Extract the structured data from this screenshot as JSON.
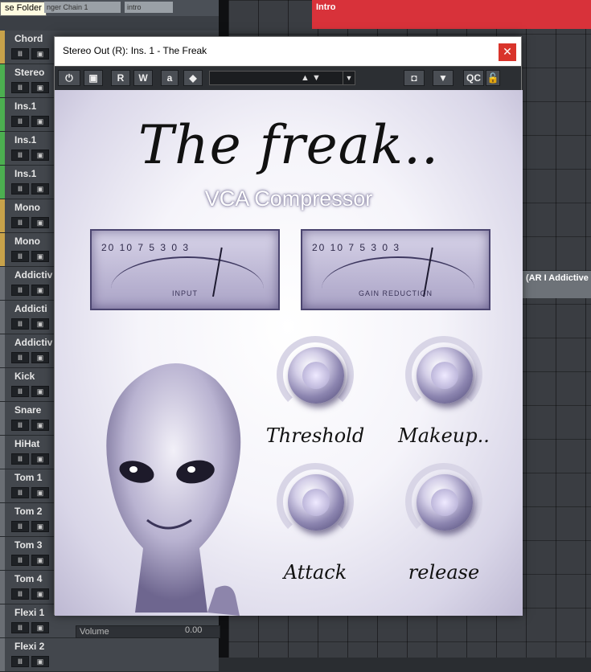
{
  "daw": {
    "tooltip": "se Folder",
    "chip1": "nger Chain 1",
    "chip2": "intro",
    "arranger_marker": "Intro",
    "right_clip": "(AR I Addictive",
    "tracks": [
      {
        "name": "Chord",
        "color": "#c8a24a"
      },
      {
        "name": "Stereo",
        "color": "#4caf50"
      },
      {
        "name": "Ins.1",
        "color": "#4caf50"
      },
      {
        "name": "Ins.1",
        "color": "#4caf50"
      },
      {
        "name": "Ins.1",
        "color": "#4caf50"
      },
      {
        "name": "Mono",
        "color": "#c8a24a"
      },
      {
        "name": "Mono",
        "color": "#c8a24a"
      },
      {
        "name": "Addictiv",
        "color": "#6a6e74"
      },
      {
        "name": "Addicti",
        "color": "#6a6e74"
      },
      {
        "name": "Addictiv",
        "color": "#6a6e74"
      },
      {
        "name": "Kick",
        "color": "#6a6e74"
      },
      {
        "name": "Snare",
        "color": "#6a6e74"
      },
      {
        "name": "HiHat",
        "color": "#6a6e74"
      },
      {
        "name": "Tom 1",
        "color": "#6a6e74"
      },
      {
        "name": "Tom 2",
        "color": "#6a6e74"
      },
      {
        "name": "Tom 3",
        "color": "#6a6e74"
      },
      {
        "name": "Tom 4",
        "color": "#6a6e74"
      },
      {
        "name": "Flexi 1",
        "color": "#6a6e74"
      },
      {
        "name": "Flexi 2",
        "color": "#6a6e74"
      }
    ],
    "volume_label": "Volume",
    "volume_value": "0.00"
  },
  "plugin": {
    "window_title": "Stereo Out (R): Ins. 1 - The Freak",
    "close_label": "✕",
    "toolbar": {
      "read": "R",
      "write": "W",
      "qc": "QC",
      "preset_value": ""
    },
    "title": "The freak..",
    "subtitle": "VCA Compressor",
    "meters": [
      {
        "scale": "20 10 7 5 3  0   3",
        "label": "INPUT"
      },
      {
        "scale": "20 10 7 5 3  0   3",
        "label": "GAIN REDUCTION"
      }
    ],
    "knobs": {
      "threshold": "Threshold",
      "makeup": "Makeup..",
      "attack": "Attack",
      "release": "release"
    }
  }
}
